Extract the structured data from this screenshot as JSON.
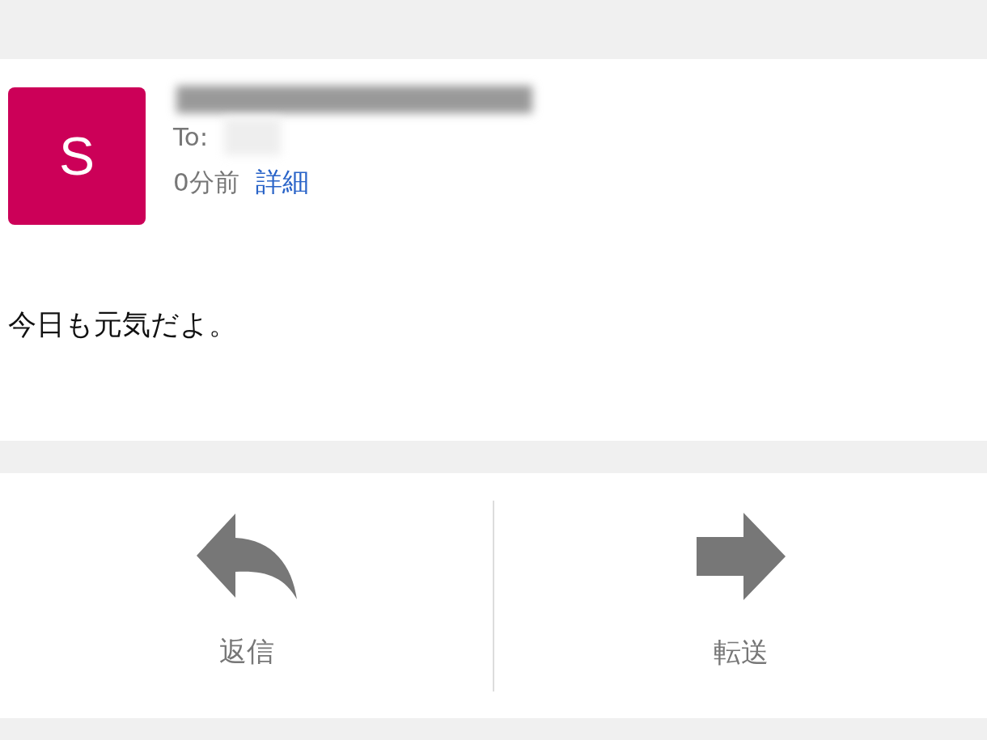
{
  "sender": {
    "initial": "S",
    "color": "#cc0058"
  },
  "recipient": {
    "label": "To:"
  },
  "time": "0分前",
  "details_link": "詳細",
  "body": "今日も元気だよ。",
  "actions": [
    {
      "kind": "reply",
      "label": "返信"
    },
    {
      "kind": "forward",
      "label": "転送"
    }
  ]
}
